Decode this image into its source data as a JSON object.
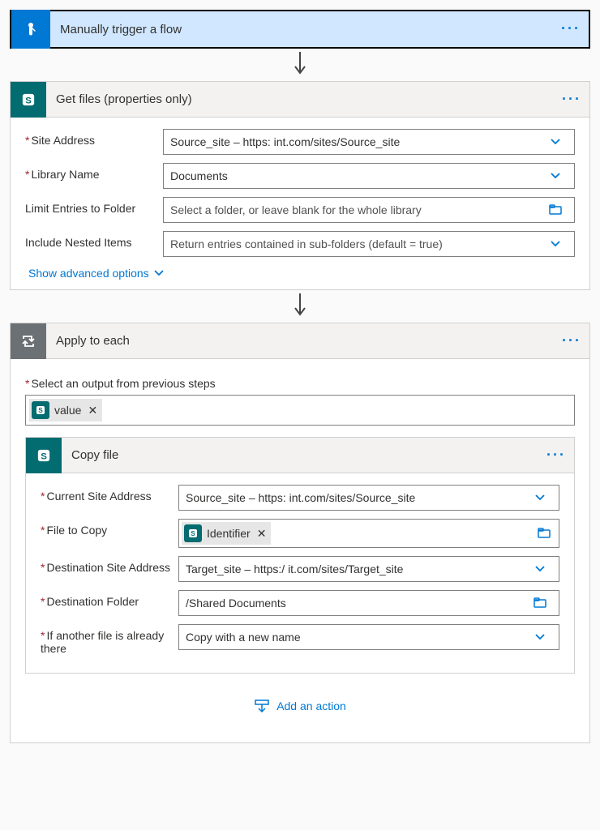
{
  "trigger": {
    "title": "Manually trigger a flow"
  },
  "getFiles": {
    "title": "Get files (properties only)",
    "fields": {
      "siteAddress": {
        "label": "Site Address",
        "value": "Source_site – https:                               int.com/sites/Source_site"
      },
      "libraryName": {
        "label": "Library Name",
        "value": "Documents"
      },
      "limitFolder": {
        "label": "Limit Entries to Folder",
        "placeholder": "Select a folder, or leave blank for the whole library"
      },
      "includeNested": {
        "label": "Include Nested Items",
        "placeholder": "Return entries contained in sub-folders (default = true)"
      }
    },
    "advanced": "Show advanced options"
  },
  "applyToEach": {
    "title": "Apply to each",
    "outputLabel": "Select an output from previous steps",
    "token": "value"
  },
  "copyFile": {
    "title": "Copy file",
    "fields": {
      "currentSite": {
        "label": "Current Site Address",
        "value": "Source_site – https:                               int.com/sites/Source_site"
      },
      "fileToCopy": {
        "label": "File to Copy",
        "token": "Identifier"
      },
      "destSite": {
        "label": "Destination Site Address",
        "value": "Target_site – https:/                             it.com/sites/Target_site"
      },
      "destFolder": {
        "label": "Destination Folder",
        "value": "/Shared Documents"
      },
      "ifExists": {
        "label": "If another file is already there",
        "value": "Copy with a new name"
      }
    }
  },
  "addAction": "Add an action"
}
